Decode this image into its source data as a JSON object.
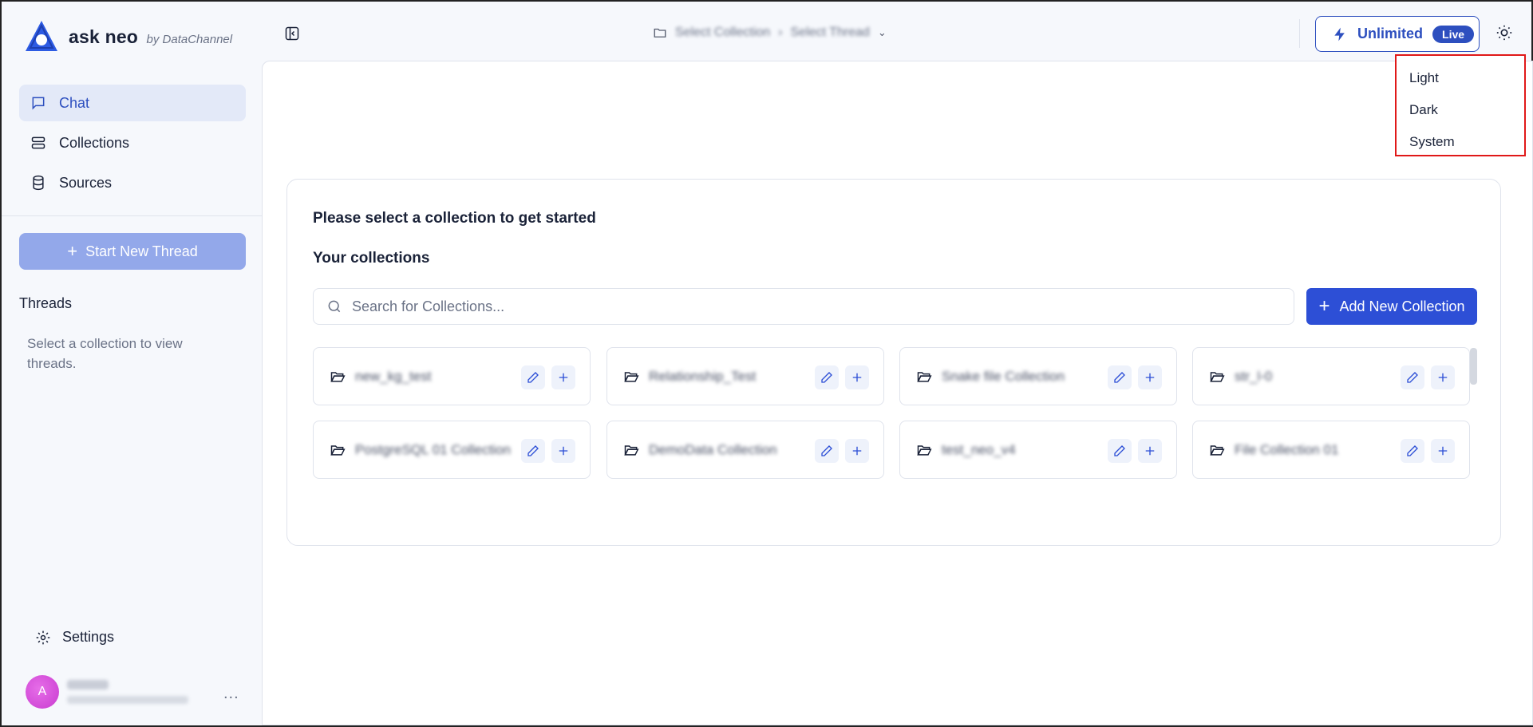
{
  "brand": {
    "name": "ask neo",
    "by": "by DataChannel"
  },
  "nav": [
    {
      "label": "Chat",
      "icon": "chat-icon",
      "active": true
    },
    {
      "label": "Collections",
      "icon": "collections-icon",
      "active": false
    },
    {
      "label": "Sources",
      "icon": "database-icon",
      "active": false
    }
  ],
  "sidebar": {
    "new_thread_label": "Start New Thread",
    "threads_title": "Threads",
    "threads_empty": "Select a collection to view threads.",
    "settings_label": "Settings",
    "user_initial": "A",
    "more_label": "..."
  },
  "breadcrumb": {
    "collection": "Select Collection",
    "thread": "Select Thread"
  },
  "plan": {
    "label": "Unlimited",
    "badge": "Live"
  },
  "theme_menu": {
    "options": [
      "Light",
      "Dark",
      "System"
    ]
  },
  "main": {
    "title": "Please select a collection to get started",
    "subtitle": "Your collections",
    "search_placeholder": "Search for Collections...",
    "add_label": "Add New Collection",
    "collections": [
      "new_kg_test",
      "Relationship_Test",
      "Snake file Collection",
      "str_l-0",
      "PostgreSQL 01 Collection",
      "DemoData Collection",
      "test_neo_v4",
      "File Collection 01"
    ]
  },
  "colors": {
    "accent": "#2d4fd6",
    "accent_soft": "#93a8ea",
    "highlight_border": "#e01818"
  }
}
